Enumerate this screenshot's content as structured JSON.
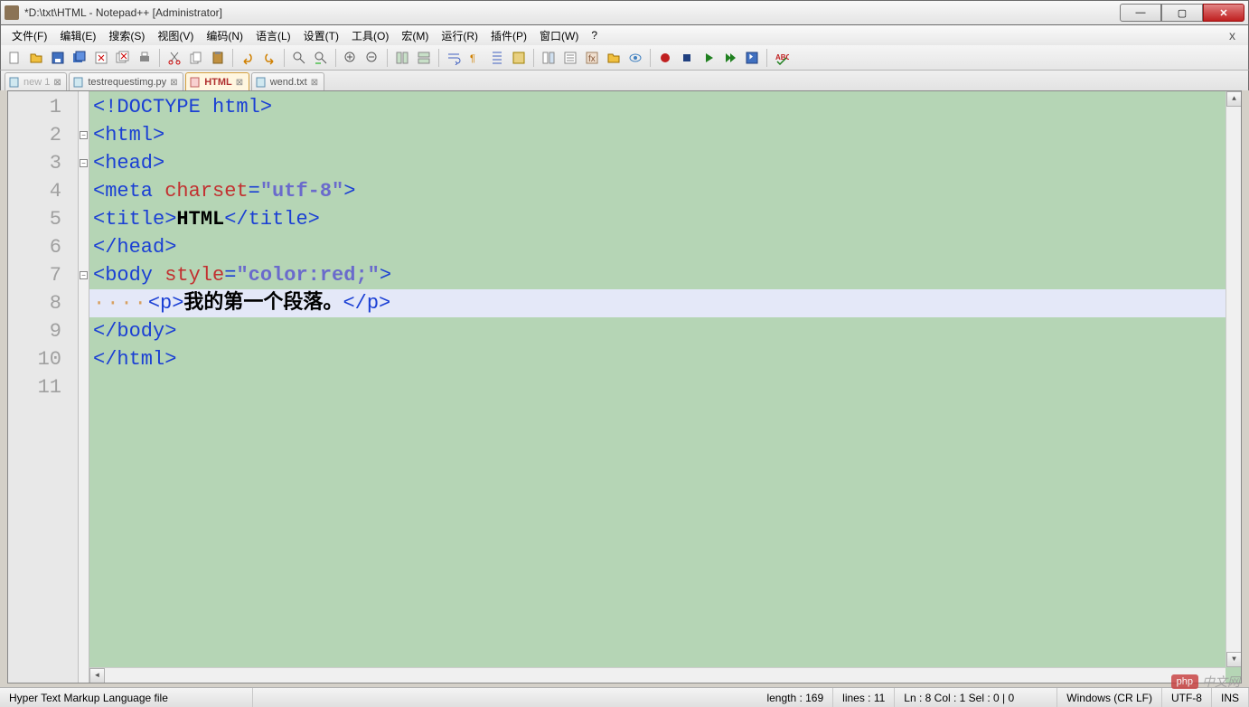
{
  "window": {
    "title": "*D:\\txt\\HTML - Notepad++ [Administrator]"
  },
  "menu": {
    "items": [
      "文件(F)",
      "编辑(E)",
      "搜索(S)",
      "视图(V)",
      "编码(N)",
      "语言(L)",
      "设置(T)",
      "工具(O)",
      "宏(M)",
      "运行(R)",
      "插件(P)",
      "窗口(W)",
      "?"
    ],
    "close": "x"
  },
  "tabs": [
    {
      "label": "new 1",
      "active": false,
      "dim": true
    },
    {
      "label": "testrequestimg.py",
      "active": false,
      "dim": false
    },
    {
      "label": "HTML",
      "active": true,
      "dim": false
    },
    {
      "label": "wend.txt",
      "active": false,
      "dim": false
    }
  ],
  "code": {
    "lines": [
      {
        "n": 1,
        "fold": "",
        "segments": [
          {
            "cls": "c-tag",
            "t": "<!DOCTYPE html>"
          }
        ]
      },
      {
        "n": 2,
        "fold": "-",
        "segments": [
          {
            "cls": "c-tag",
            "t": "<html>"
          }
        ]
      },
      {
        "n": 3,
        "fold": "-",
        "segments": [
          {
            "cls": "c-tag",
            "t": "<head>"
          }
        ]
      },
      {
        "n": 4,
        "fold": "",
        "segments": [
          {
            "cls": "c-tag",
            "t": "<meta "
          },
          {
            "cls": "c-attr",
            "t": "charset"
          },
          {
            "cls": "c-tag",
            "t": "="
          },
          {
            "cls": "c-str",
            "t": "\"utf-8\""
          },
          {
            "cls": "c-tag",
            "t": ">"
          }
        ]
      },
      {
        "n": 5,
        "fold": "",
        "segments": [
          {
            "cls": "c-tag",
            "t": "<title>"
          },
          {
            "cls": "c-text",
            "t": "HTML"
          },
          {
            "cls": "c-tag",
            "t": "</title>"
          }
        ]
      },
      {
        "n": 6,
        "fold": "",
        "segments": [
          {
            "cls": "c-tag",
            "t": "</head>"
          }
        ]
      },
      {
        "n": 7,
        "fold": "-",
        "segments": [
          {
            "cls": "c-tag",
            "t": "<body "
          },
          {
            "cls": "c-attr",
            "t": "style"
          },
          {
            "cls": "c-tag",
            "t": "="
          },
          {
            "cls": "c-str",
            "t": "\"color:red;\""
          },
          {
            "cls": "c-tag",
            "t": ">"
          }
        ]
      },
      {
        "n": 8,
        "fold": "",
        "hl": true,
        "segments": [
          {
            "cls": "c-dots",
            "t": "····"
          },
          {
            "cls": "c-tag",
            "t": "<p>"
          },
          {
            "cls": "c-text",
            "t": "我的第一个段落。"
          },
          {
            "cls": "c-tag",
            "t": "</p>"
          }
        ]
      },
      {
        "n": 9,
        "fold": "",
        "segments": [
          {
            "cls": "c-tag",
            "t": "</body>"
          }
        ]
      },
      {
        "n": 10,
        "fold": "",
        "segments": [
          {
            "cls": "c-tag",
            "t": "</html>"
          }
        ]
      },
      {
        "n": 11,
        "fold": "",
        "segments": []
      }
    ]
  },
  "status": {
    "lang": "Hyper Text Markup Language file",
    "length": "length : 169",
    "lines": "lines : 11",
    "pos": "Ln : 8    Col : 1    Sel : 0 | 0",
    "eol": "Windows (CR LF)",
    "enc": "UTF-8",
    "ins": "INS"
  },
  "watermark": {
    "logo": "php",
    "text": "中文网"
  }
}
